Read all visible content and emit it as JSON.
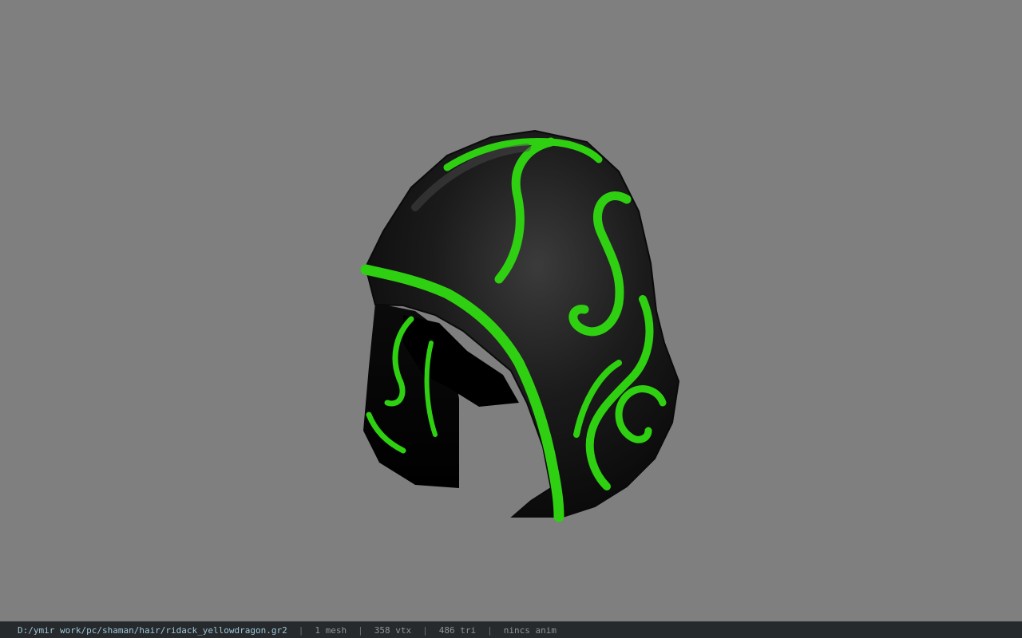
{
  "status_bar": {
    "file_path": "D:/ymir work/pc/shaman/hair/ridack_yellowdragon.gr2",
    "separator": "|",
    "mesh_count": "1 mesh",
    "vertex_count": "358 vtx",
    "triangle_count": "486 tri",
    "anim_info": "nincs anim"
  },
  "viewport": {
    "background_color": "#7f7f7f",
    "model_name": "black-green-hood-model"
  },
  "colors": {
    "hood_base": "#111111",
    "hood_trim": "#2fd012",
    "statusbar_bg": "#262a2c",
    "path_text": "#9fc6d8"
  }
}
